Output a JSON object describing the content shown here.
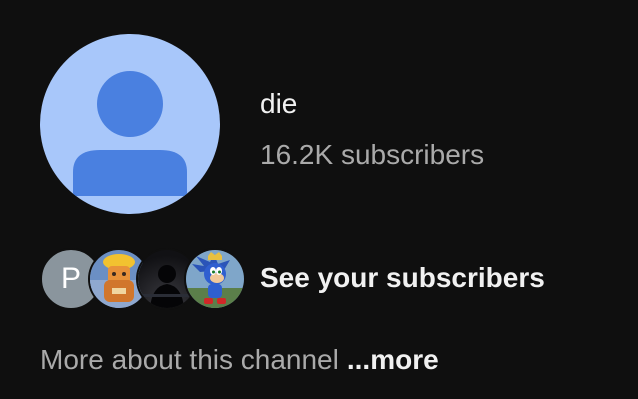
{
  "channel": {
    "name": "die",
    "subscriber_count": "16.2K subscribers",
    "avatar_icon": "default-person-avatar-icon",
    "avatar_bg": "#a8c7fa",
    "avatar_fg": "#4a80e0"
  },
  "subscribers_preview": {
    "first_initial": "P",
    "action_label": "See your subscribers"
  },
  "about": {
    "text": "More about this channel",
    "more_label": "...more"
  }
}
